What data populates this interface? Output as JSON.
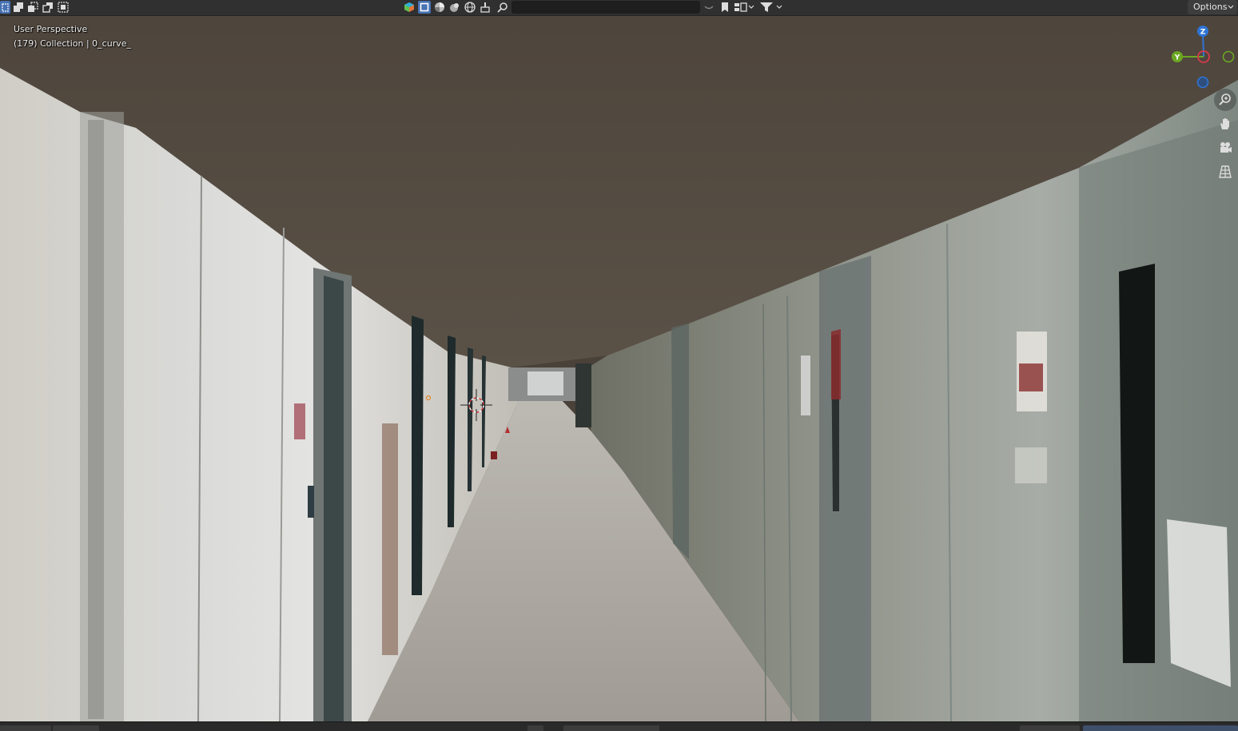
{
  "header": {
    "select_modes": [
      "select-box-icon",
      "select-extend-icon",
      "select-subtract-icon",
      "select-invert-icon"
    ],
    "shading_modes": [
      "overlay-icon",
      "solid-shading-icon",
      "material-preview-icon",
      "rendered-icon",
      "wireframe-icon",
      "brush-icon"
    ],
    "search": {
      "value": "",
      "placeholder": ""
    },
    "options_label": "Options"
  },
  "viewport": {
    "view_name": "User Perspective",
    "object_info": "(179) Collection | 0_curve_"
  },
  "gizmo": {
    "axes": [
      {
        "label": "Z",
        "color": "#2f75d6"
      },
      {
        "label": "Y",
        "color": "#6ba723"
      },
      {
        "label": "X",
        "color": "#d9394b"
      }
    ]
  },
  "navigation": [
    "zoom-icon",
    "pan-hand-icon",
    "camera-icon",
    "grid-icon"
  ],
  "colors": {
    "header_bg": "#303030",
    "active_blue": "#4772b3",
    "ceiling": "#4a4139",
    "floor": "#a8a39d"
  }
}
